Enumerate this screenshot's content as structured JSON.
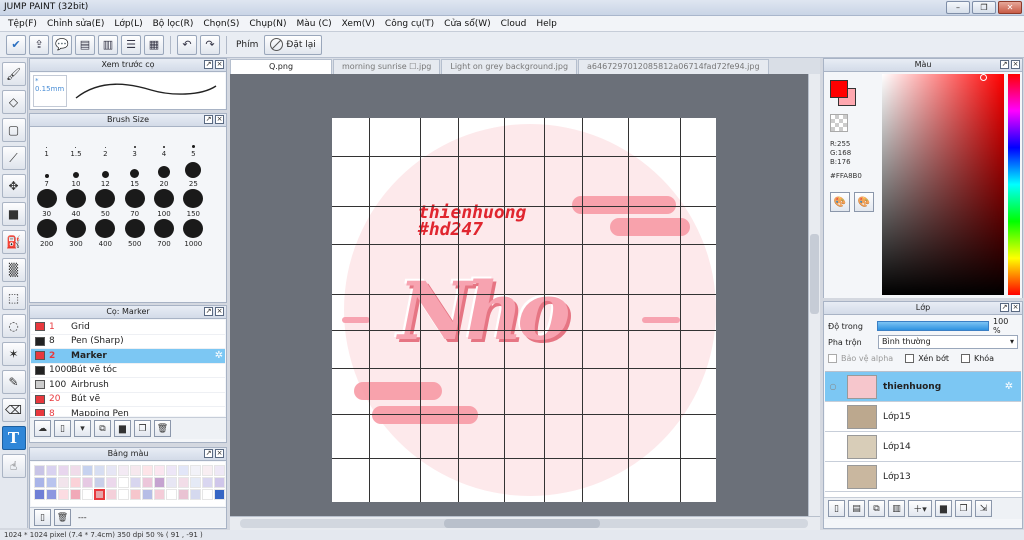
{
  "window": {
    "title": "JUMP PAINT (32bit)",
    "buttons": [
      "–",
      "❐",
      "✕"
    ]
  },
  "menu": [
    "Tệp(F)",
    "Chỉnh sửa(E)",
    "Lớp(L)",
    "Bộ lọc(R)",
    "Chọn(S)",
    "Chụp(N)",
    "Màu (C)",
    "Xem(V)",
    "Công cụ(T)",
    "Cửa sổ(W)",
    "Cloud",
    "Help"
  ],
  "toolbar": {
    "phim_label": "Phím",
    "reset_label": "Đặt lại"
  },
  "brush_preview": {
    "title": "Xem trước cọ",
    "size": "* 0.15mm"
  },
  "brush_size": {
    "title": "Brush Size",
    "sizes": [
      {
        "label": "1",
        "d": 1
      },
      {
        "label": "1.5",
        "d": 1
      },
      {
        "label": "2",
        "d": 1.5
      },
      {
        "label": "3",
        "d": 2
      },
      {
        "label": "4",
        "d": 2.5
      },
      {
        "label": "5",
        "d": 3
      },
      {
        "label": "7",
        "d": 4
      },
      {
        "label": "10",
        "d": 6
      },
      {
        "label": "12",
        "d": 7
      },
      {
        "label": "15",
        "d": 9
      },
      {
        "label": "20",
        "d": 12
      },
      {
        "label": "25",
        "d": 16
      },
      {
        "label": "30",
        "d": 20
      },
      {
        "label": "40",
        "d": 20
      },
      {
        "label": "50",
        "d": 20
      },
      {
        "label": "70",
        "d": 20
      },
      {
        "label": "100",
        "d": 20
      },
      {
        "label": "150",
        "d": 20
      },
      {
        "label": "200",
        "d": 20
      },
      {
        "label": "300",
        "d": 20
      },
      {
        "label": "400",
        "d": 20
      },
      {
        "label": "500",
        "d": 20
      },
      {
        "label": "700",
        "d": 20
      },
      {
        "label": "1000",
        "d": 20
      }
    ]
  },
  "brushes": {
    "title": "Cọ: Marker",
    "items": [
      {
        "num": "1",
        "name": "Grid",
        "color": "#e8383d"
      },
      {
        "num": "8",
        "name": "Pen (Sharp)",
        "color": "#222222"
      },
      {
        "num": "2",
        "name": "Marker",
        "color": "#e8383d",
        "selected": true
      },
      {
        "num": "1000",
        "name": "Bút vẽ tóc",
        "color": "#222222"
      },
      {
        "num": "100",
        "name": "Airbrush",
        "color": "#cccccc"
      },
      {
        "num": "20",
        "name": "Bút vẽ",
        "color": "#e8383d"
      },
      {
        "num": "8",
        "name": "Mapping Pen",
        "color": "#e8383d"
      }
    ]
  },
  "palette": {
    "title": "Bảng màu",
    "footer_text": "---",
    "colors": [
      "#c8c4e6",
      "#d9d2f0",
      "#e8d6ee",
      "#f0dcea",
      "#c6d2ef",
      "#d7def2",
      "#e6e6f5",
      "#f3eaf4",
      "#f6e8ee",
      "#fde4e8",
      "#fbe6f0",
      "#ede6f7",
      "#e2e6f8",
      "#f2f2f8",
      "#f8eef2",
      "#eee8f6",
      "#a9b4e8",
      "#b9c4ee",
      "#f2e4ec",
      "#fbd2d8",
      "#e6c9e3",
      "#c9cfe9",
      "#ecd8ec",
      "#ffffff",
      "#d8d6ef",
      "#ecc6da",
      "#c5a3d0",
      "#e7e6f4",
      "#f2dde8",
      "#e5eaf6",
      "#d9d6f0",
      "#cfc6ea",
      "#6f7fd6",
      "#8c98e0",
      "#fcdce2",
      "#f1a9b8",
      "#ffffff",
      "#e6a4a8",
      "#f4d0da",
      "#ffffff",
      "#f6c6cc",
      "#b6bde6",
      "#f4ccd8",
      "#ffffff",
      "#e9c3d3",
      "#d5d9ef",
      "#ffffff",
      "#3565c4"
    ]
  },
  "tabs": [
    "Q.png",
    "morning sunrise ☐.jpg",
    "Light on grey background.jpg",
    "a6467297012085812a06714fad72fe94.jpg"
  ],
  "artwork": {
    "watermark": "thienhuong\n#hd247",
    "title_text": "Nho"
  },
  "color_panel": {
    "title": "Màu",
    "r": "R:255",
    "g": "G:168",
    "b": "B:176",
    "hex": "#FFA8B0"
  },
  "layer_panel": {
    "title": "Lớp",
    "opacity_label": "Độ trong",
    "opacity_value": "100 %",
    "blend_label": "Pha trộn",
    "blend_value": "Bình thường",
    "protect_alpha": "Bảo vệ alpha",
    "clip": "Xén bớt",
    "lock": "Khóa",
    "layers": [
      {
        "name": "thienhuong",
        "selected": true
      },
      {
        "name": "Lớp15"
      },
      {
        "name": "Lớp14"
      },
      {
        "name": "Lớp13"
      }
    ]
  },
  "status": "1024 * 1024 pixel   (7.4 * 7.4cm)   350 dpi   50 %   ( 91 , -91 )"
}
